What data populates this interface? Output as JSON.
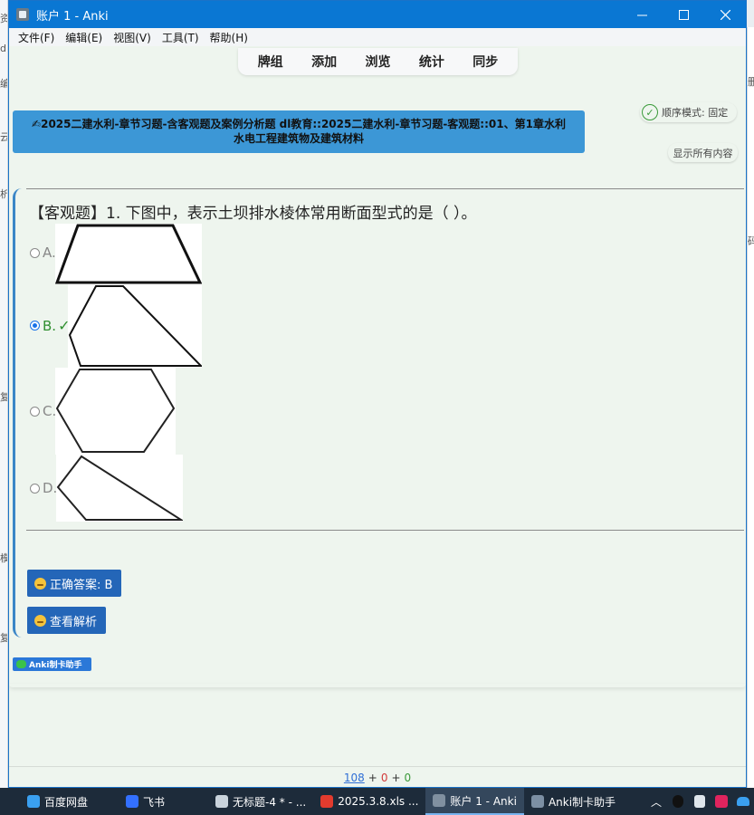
{
  "window": {
    "title": "账户 1 - Anki",
    "minimize_icon": "minimize-icon",
    "maximize_icon": "maximize-icon",
    "close_icon": "close-icon"
  },
  "menu": [
    "文件(F)",
    "编辑(E)",
    "视图(V)",
    "工具(T)",
    "帮助(H)"
  ],
  "toolbar": [
    "牌组",
    "添加",
    "浏览",
    "统计",
    "同步"
  ],
  "deck_banner": {
    "line1": "✍2025二建水利-章节习题-含客观题及案例分析题 dl教育::2025二建水利-章节习题-客观题::01、第1章水利",
    "line2": "水电工程建筑物及建筑材料"
  },
  "mode_pill": "顺序模式: 固定",
  "show_all": "显示所有内容",
  "question": "【客观题】1. 下图中，表示土坝排水棱体常用断面型式的是（ ）。",
  "options": [
    {
      "label": "A.",
      "selected": false,
      "correct": false
    },
    {
      "label": "B.",
      "selected": true,
      "correct": true
    },
    {
      "label": "C.",
      "selected": false,
      "correct": false
    },
    {
      "label": "D.",
      "selected": false,
      "correct": false
    }
  ],
  "correct_mark": "✓",
  "buttons": {
    "answer": "正确答案: B",
    "analysis": "查看解析"
  },
  "helper_badge": "Anki制卡助手",
  "status": {
    "new": "108",
    "plus1": "+",
    "learn": "0",
    "plus2": "+",
    "review": "0"
  },
  "taskbar": [
    {
      "label": "百度网盘",
      "icon": "baidu-netdisk-icon",
      "active": false
    },
    {
      "label": "飞书",
      "icon": "feishu-icon",
      "active": false
    },
    {
      "label": "无标题-4 * - ...",
      "icon": "notepad-icon",
      "active": false
    },
    {
      "label": "2025.3.8.xls ...",
      "icon": "wps-icon",
      "active": false
    },
    {
      "label": "账户 1 - Anki",
      "icon": "anki-icon",
      "active": true
    },
    {
      "label": "Anki制卡助手",
      "icon": "anki-helper-icon",
      "active": false
    }
  ],
  "colors": {
    "titlebar": "#0a77d3",
    "deck_banner": "#3c97d6",
    "answer_button": "#2466b8",
    "correct": "#2f8f2f",
    "card_border": "#3b86c7",
    "taskbar": "#1d2b3a"
  }
}
